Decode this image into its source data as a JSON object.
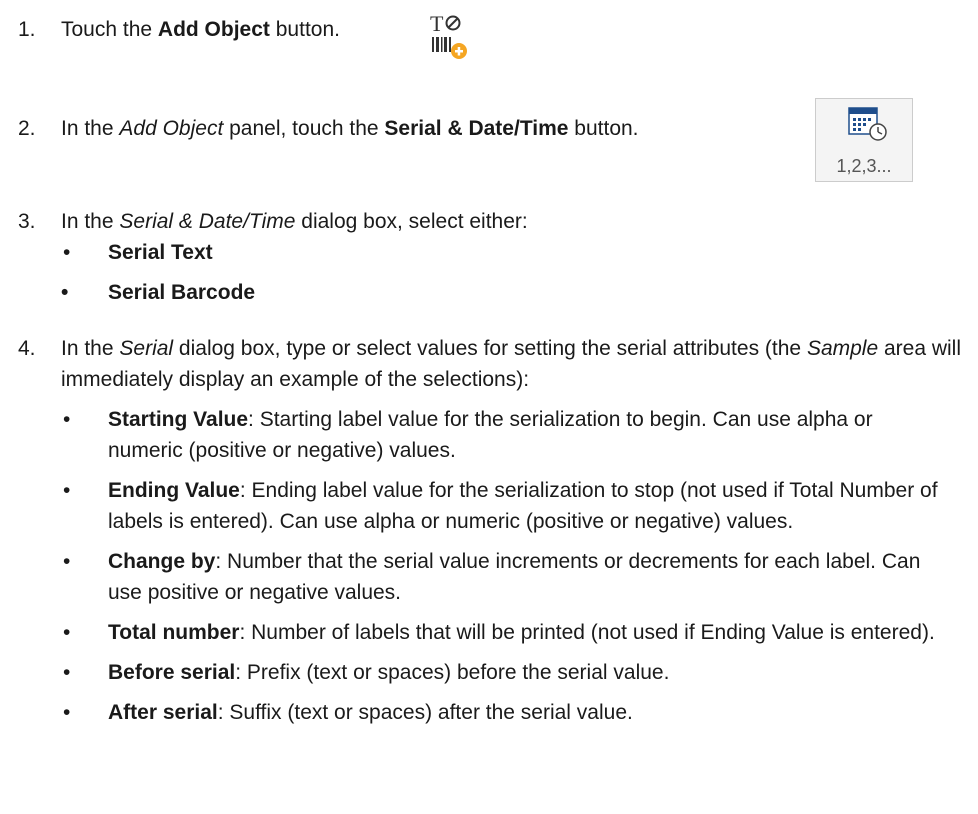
{
  "steps": [
    {
      "number": "1.",
      "pre": "Touch the ",
      "bold": "Add Object",
      "post": " button."
    },
    {
      "number": "2.",
      "pre": "In the ",
      "italic": "Add Object",
      "mid": " panel, touch the ",
      "bold": "Serial & Date/Time",
      "post": " button."
    },
    {
      "number": "3.",
      "pre": "In the ",
      "italic": "Serial & Date/Time",
      "post": " dialog box, select either:",
      "bullets": [
        "Serial Text",
        "Serial Barcode"
      ]
    },
    {
      "number": "4.",
      "pre": "In the ",
      "italic": "Serial",
      "mid": " dialog box, type or select values for setting the serial attributes (the ",
      "italic2": "Sample",
      "post": " area will immediately display an example of the selections):",
      "bullets": [
        {
          "term": "Starting Value",
          "desc": ": Starting label value for the serialization to begin. Can use alpha or numeric (positive or negative) values."
        },
        {
          "term": "Ending Value",
          "desc": ": Ending label value for the serialization to stop (not used if Total Number of labels is entered). Can use alpha or numeric (positive or negative) values."
        },
        {
          "term": "Change by",
          "desc": ": Number that the serial value increments or decrements for each label. Can use positive or negative values."
        },
        {
          "term": "Total number",
          "desc": ": Number of labels that will be printed (not used if Ending Value is entered)."
        },
        {
          "term": "Before serial",
          "desc": ": Prefix (text or spaces) before the serial value."
        },
        {
          "term": "After serial",
          "desc": ": Suffix (text or spaces) after the serial value."
        }
      ]
    }
  ],
  "icons": {
    "add_object": "add-object-icon",
    "serial_date_time": "serial-date-time-icon",
    "serial_caption": "1,2,3...",
    "accent_orange": "#f5a623",
    "accent_blue": "#1f4e8c"
  }
}
